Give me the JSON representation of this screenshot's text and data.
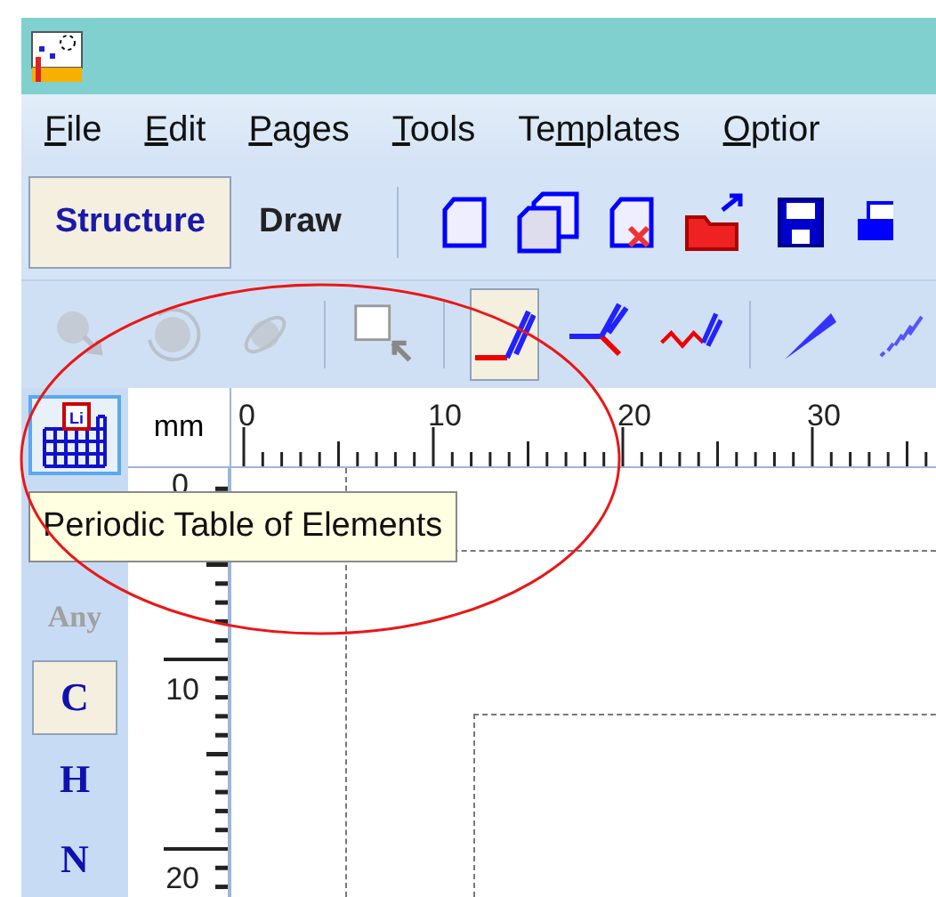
{
  "menu": [
    {
      "mnemonic": "F",
      "rest": "ile"
    },
    {
      "mnemonic": "E",
      "rest": "dit"
    },
    {
      "mnemonic": "P",
      "rest": "ages"
    },
    {
      "mnemonic": "T",
      "rest": "ools"
    },
    {
      "lead": "Te",
      "mnemonic": "m",
      "rest": "plates"
    },
    {
      "mnemonic": "O",
      "rest": "ptior"
    }
  ],
  "modes": [
    {
      "label": "Structure",
      "selected": true
    },
    {
      "label": "Draw",
      "selected": false
    }
  ],
  "file_tools": [
    {
      "kind": "new-page"
    },
    {
      "kind": "copy-pages"
    },
    {
      "kind": "delete-page"
    },
    {
      "kind": "open"
    },
    {
      "kind": "save"
    },
    {
      "kind": "print"
    }
  ],
  "draw_tool_groups": [
    [
      {
        "kind": "atom",
        "disabled": true,
        "selected": false
      },
      {
        "kind": "rotate",
        "disabled": true,
        "selected": false
      },
      {
        "kind": "orbit",
        "disabled": true,
        "selected": false
      }
    ],
    [
      {
        "kind": "select",
        "disabled": false,
        "selected": false
      }
    ],
    [
      {
        "kind": "draw-normal",
        "disabled": false,
        "selected": true
      },
      {
        "kind": "draw-chain",
        "disabled": false,
        "selected": false
      },
      {
        "kind": "draw-zigzag",
        "disabled": false,
        "selected": false
      }
    ],
    [
      {
        "kind": "wedge",
        "disabled": false,
        "selected": false
      },
      {
        "kind": "hashed",
        "disabled": false,
        "selected": false
      }
    ]
  ],
  "palette": [
    {
      "kind": "table",
      "label": "Li",
      "hovered": true,
      "selected": false,
      "disabled": false
    },
    {
      "kind": "element",
      "label": "Any",
      "hovered": false,
      "selected": false,
      "disabled": true
    },
    {
      "kind": "element",
      "label": "C",
      "hovered": false,
      "selected": true,
      "disabled": false
    },
    {
      "kind": "element",
      "label": "H",
      "hovered": false,
      "selected": false,
      "disabled": false
    },
    {
      "kind": "element",
      "label": "N",
      "hovered": false,
      "selected": false,
      "disabled": false
    }
  ],
  "ruler": {
    "unit": "mm",
    "top_labels": [
      "0",
      "10",
      "20",
      "30"
    ],
    "side_labels": [
      "0",
      "10",
      "20"
    ]
  },
  "tooltip": "Periodic Table of Elements"
}
